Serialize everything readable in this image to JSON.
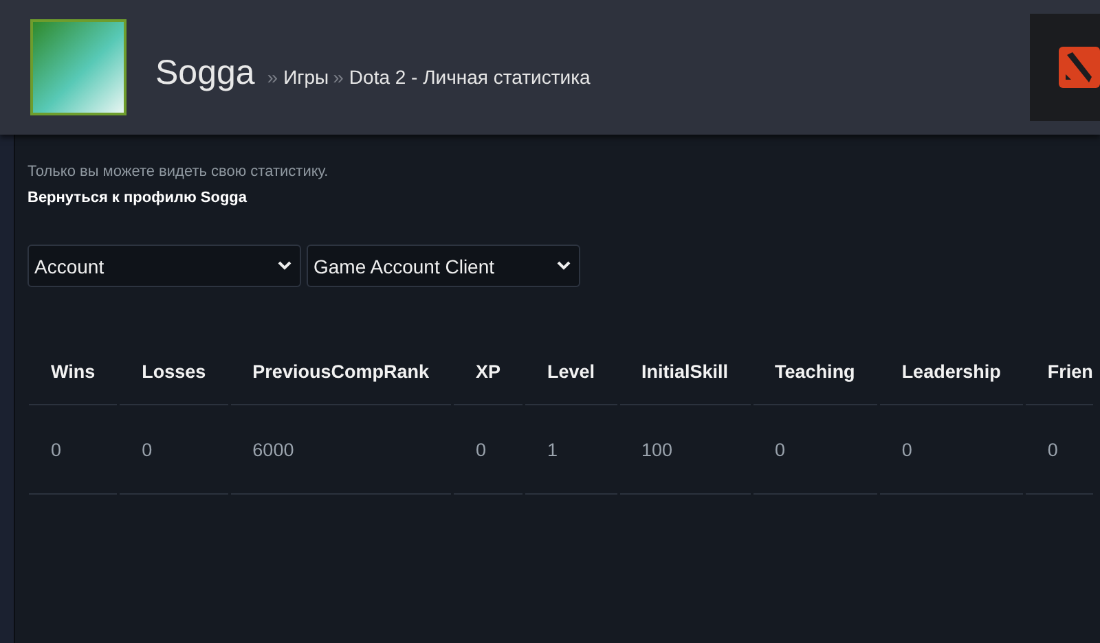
{
  "header": {
    "user_name": "Sogga",
    "breadcrumbs": [
      {
        "separator": "»",
        "label": "Игры"
      },
      {
        "separator": "»",
        "label": "Dota 2 - Личная статистика"
      }
    ]
  },
  "notice": "Только вы можете видеть свою статистику.",
  "back_link": "Вернуться к профилю Sogga",
  "filters": [
    {
      "value": "Account"
    },
    {
      "value": "Game Account Client"
    }
  ],
  "table": {
    "columns": [
      "Wins",
      "Losses",
      "PreviousCompRank",
      "XP",
      "Level",
      "InitialSkill",
      "Teaching",
      "Leadership",
      "Frien"
    ],
    "rows": [
      [
        "0",
        "0",
        "6000",
        "0",
        "1",
        "100",
        "0",
        "0",
        "0"
      ]
    ]
  }
}
